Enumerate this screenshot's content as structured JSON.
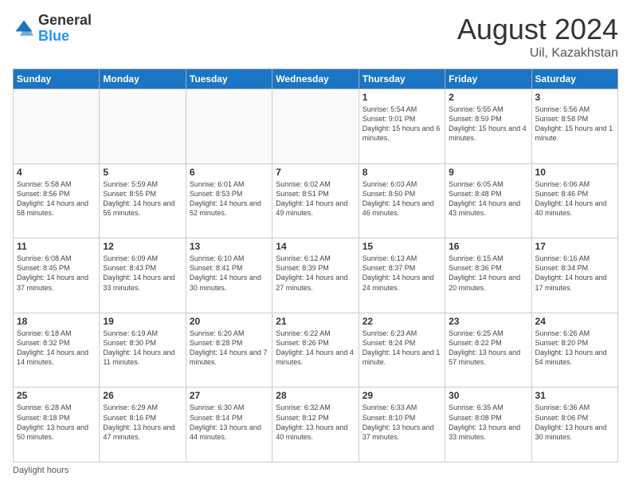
{
  "logo": {
    "general": "General",
    "blue": "Blue"
  },
  "header": {
    "month": "August 2024",
    "location": "Uil, Kazakhstan"
  },
  "days_of_week": [
    "Sunday",
    "Monday",
    "Tuesday",
    "Wednesday",
    "Thursday",
    "Friday",
    "Saturday"
  ],
  "weeks": [
    [
      {
        "day": "",
        "sunrise": "",
        "sunset": "",
        "daylight": "",
        "empty": true
      },
      {
        "day": "",
        "sunrise": "",
        "sunset": "",
        "daylight": "",
        "empty": true
      },
      {
        "day": "",
        "sunrise": "",
        "sunset": "",
        "daylight": "",
        "empty": true
      },
      {
        "day": "",
        "sunrise": "",
        "sunset": "",
        "daylight": "",
        "empty": true
      },
      {
        "day": "1",
        "sunrise": "Sunrise: 5:54 AM",
        "sunset": "Sunset: 9:01 PM",
        "daylight": "Daylight: 15 hours and 6 minutes.",
        "empty": false
      },
      {
        "day": "2",
        "sunrise": "Sunrise: 5:55 AM",
        "sunset": "Sunset: 8:59 PM",
        "daylight": "Daylight: 15 hours and 4 minutes.",
        "empty": false
      },
      {
        "day": "3",
        "sunrise": "Sunrise: 5:56 AM",
        "sunset": "Sunset: 8:58 PM",
        "daylight": "Daylight: 15 hours and 1 minute.",
        "empty": false
      }
    ],
    [
      {
        "day": "4",
        "sunrise": "Sunrise: 5:58 AM",
        "sunset": "Sunset: 8:56 PM",
        "daylight": "Daylight: 14 hours and 58 minutes.",
        "empty": false
      },
      {
        "day": "5",
        "sunrise": "Sunrise: 5:59 AM",
        "sunset": "Sunset: 8:55 PM",
        "daylight": "Daylight: 14 hours and 55 minutes.",
        "empty": false
      },
      {
        "day": "6",
        "sunrise": "Sunrise: 6:01 AM",
        "sunset": "Sunset: 8:53 PM",
        "daylight": "Daylight: 14 hours and 52 minutes.",
        "empty": false
      },
      {
        "day": "7",
        "sunrise": "Sunrise: 6:02 AM",
        "sunset": "Sunset: 8:51 PM",
        "daylight": "Daylight: 14 hours and 49 minutes.",
        "empty": false
      },
      {
        "day": "8",
        "sunrise": "Sunrise: 6:03 AM",
        "sunset": "Sunset: 8:50 PM",
        "daylight": "Daylight: 14 hours and 46 minutes.",
        "empty": false
      },
      {
        "day": "9",
        "sunrise": "Sunrise: 6:05 AM",
        "sunset": "Sunset: 8:48 PM",
        "daylight": "Daylight: 14 hours and 43 minutes.",
        "empty": false
      },
      {
        "day": "10",
        "sunrise": "Sunrise: 6:06 AM",
        "sunset": "Sunset: 8:46 PM",
        "daylight": "Daylight: 14 hours and 40 minutes.",
        "empty": false
      }
    ],
    [
      {
        "day": "11",
        "sunrise": "Sunrise: 6:08 AM",
        "sunset": "Sunset: 8:45 PM",
        "daylight": "Daylight: 14 hours and 37 minutes.",
        "empty": false
      },
      {
        "day": "12",
        "sunrise": "Sunrise: 6:09 AM",
        "sunset": "Sunset: 8:43 PM",
        "daylight": "Daylight: 14 hours and 33 minutes.",
        "empty": false
      },
      {
        "day": "13",
        "sunrise": "Sunrise: 6:10 AM",
        "sunset": "Sunset: 8:41 PM",
        "daylight": "Daylight: 14 hours and 30 minutes.",
        "empty": false
      },
      {
        "day": "14",
        "sunrise": "Sunrise: 6:12 AM",
        "sunset": "Sunset: 8:39 PM",
        "daylight": "Daylight: 14 hours and 27 minutes.",
        "empty": false
      },
      {
        "day": "15",
        "sunrise": "Sunrise: 6:13 AM",
        "sunset": "Sunset: 8:37 PM",
        "daylight": "Daylight: 14 hours and 24 minutes.",
        "empty": false
      },
      {
        "day": "16",
        "sunrise": "Sunrise: 6:15 AM",
        "sunset": "Sunset: 8:36 PM",
        "daylight": "Daylight: 14 hours and 20 minutes.",
        "empty": false
      },
      {
        "day": "17",
        "sunrise": "Sunrise: 6:16 AM",
        "sunset": "Sunset: 8:34 PM",
        "daylight": "Daylight: 14 hours and 17 minutes.",
        "empty": false
      }
    ],
    [
      {
        "day": "18",
        "sunrise": "Sunrise: 6:18 AM",
        "sunset": "Sunset: 8:32 PM",
        "daylight": "Daylight: 14 hours and 14 minutes.",
        "empty": false
      },
      {
        "day": "19",
        "sunrise": "Sunrise: 6:19 AM",
        "sunset": "Sunset: 8:30 PM",
        "daylight": "Daylight: 14 hours and 11 minutes.",
        "empty": false
      },
      {
        "day": "20",
        "sunrise": "Sunrise: 6:20 AM",
        "sunset": "Sunset: 8:28 PM",
        "daylight": "Daylight: 14 hours and 7 minutes.",
        "empty": false
      },
      {
        "day": "21",
        "sunrise": "Sunrise: 6:22 AM",
        "sunset": "Sunset: 8:26 PM",
        "daylight": "Daylight: 14 hours and 4 minutes.",
        "empty": false
      },
      {
        "day": "22",
        "sunrise": "Sunrise: 6:23 AM",
        "sunset": "Sunset: 8:24 PM",
        "daylight": "Daylight: 14 hours and 1 minute.",
        "empty": false
      },
      {
        "day": "23",
        "sunrise": "Sunrise: 6:25 AM",
        "sunset": "Sunset: 8:22 PM",
        "daylight": "Daylight: 13 hours and 57 minutes.",
        "empty": false
      },
      {
        "day": "24",
        "sunrise": "Sunrise: 6:26 AM",
        "sunset": "Sunset: 8:20 PM",
        "daylight": "Daylight: 13 hours and 54 minutes.",
        "empty": false
      }
    ],
    [
      {
        "day": "25",
        "sunrise": "Sunrise: 6:28 AM",
        "sunset": "Sunset: 8:18 PM",
        "daylight": "Daylight: 13 hours and 50 minutes.",
        "empty": false
      },
      {
        "day": "26",
        "sunrise": "Sunrise: 6:29 AM",
        "sunset": "Sunset: 8:16 PM",
        "daylight": "Daylight: 13 hours and 47 minutes.",
        "empty": false
      },
      {
        "day": "27",
        "sunrise": "Sunrise: 6:30 AM",
        "sunset": "Sunset: 8:14 PM",
        "daylight": "Daylight: 13 hours and 44 minutes.",
        "empty": false
      },
      {
        "day": "28",
        "sunrise": "Sunrise: 6:32 AM",
        "sunset": "Sunset: 8:12 PM",
        "daylight": "Daylight: 13 hours and 40 minutes.",
        "empty": false
      },
      {
        "day": "29",
        "sunrise": "Sunrise: 6:33 AM",
        "sunset": "Sunset: 8:10 PM",
        "daylight": "Daylight: 13 hours and 37 minutes.",
        "empty": false
      },
      {
        "day": "30",
        "sunrise": "Sunrise: 6:35 AM",
        "sunset": "Sunset: 8:08 PM",
        "daylight": "Daylight: 13 hours and 33 minutes.",
        "empty": false
      },
      {
        "day": "31",
        "sunrise": "Sunrise: 6:36 AM",
        "sunset": "Sunset: 8:06 PM",
        "daylight": "Daylight: 13 hours and 30 minutes.",
        "empty": false
      }
    ]
  ],
  "footer": {
    "note": "Daylight hours"
  }
}
